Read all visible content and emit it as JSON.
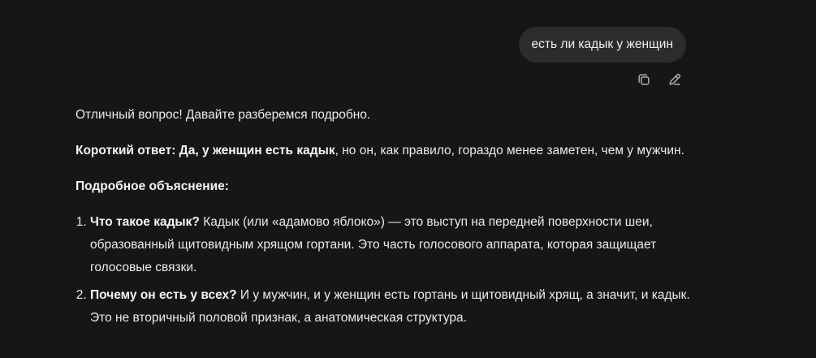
{
  "user_message": {
    "text": "есть ли кадык у женщин"
  },
  "message_actions": [
    {
      "name": "copy-icon",
      "label": "Copy"
    },
    {
      "name": "edit-icon",
      "label": "Edit"
    }
  ],
  "answer": {
    "intro": "Отличный вопрос! Давайте разберемся подробно.",
    "short_label": "Короткий ответ: Да, у женщин есть кадык",
    "short_rest": ", но он, как правило, гораздо менее заметен, чем у мужчин.",
    "detail_heading": "Подробное объяснение:",
    "points": [
      {
        "bold": "Что такое кадык?",
        "text": " Кадык (или «адамово яблоко») — это выступ на передней поверхности шеи, образованный щитовидным хрящом гортани. Это часть голосового аппарата, которая защищает голосовые связки."
      },
      {
        "bold": "Почему он есть у всех?",
        "text": " И у мужчин, и у женщин есть гортань и щитовидный хрящ, а значит, и кадык. Это не вторичный половой признак, а анатомическая структура."
      }
    ]
  }
}
